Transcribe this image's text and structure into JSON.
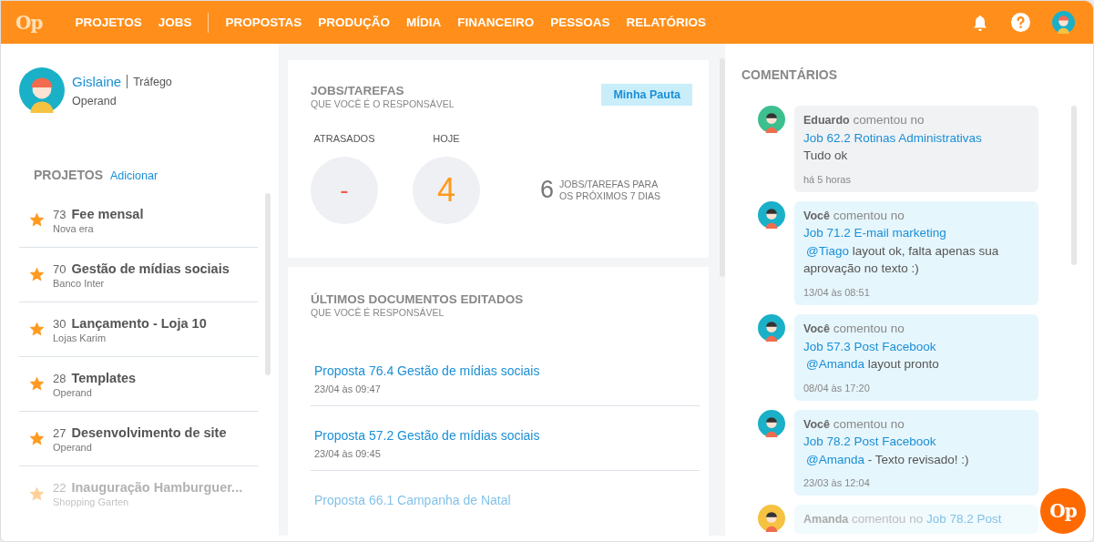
{
  "header": {
    "logo": "Op",
    "nav": [
      {
        "label": "PROJETOS",
        "selected": false
      },
      {
        "label": "JOBS",
        "selected": false
      },
      {
        "label": "PROPOSTAS",
        "selected": false
      },
      {
        "label": "PRODUÇÃO",
        "selected": false
      },
      {
        "label": "MÍDIA",
        "selected": false
      },
      {
        "label": "FINANCEIRO",
        "selected": false
      },
      {
        "label": "PESSOAS",
        "selected": false
      },
      {
        "label": "RELATÓRIOS",
        "selected": false
      }
    ]
  },
  "profile": {
    "name": "Gislaine",
    "role": "Tráfego",
    "company": "Operand"
  },
  "projects": {
    "title": "PROJETOS",
    "add_link": "Adicionar",
    "items": [
      {
        "number": "73",
        "name": "Fee mensal",
        "client": "Nova era",
        "starred": true
      },
      {
        "number": "70",
        "name": "Gestão de mídias sociais",
        "client": "Banco Inter",
        "starred": true
      },
      {
        "number": "30",
        "name": "Lançamento - Loja 10",
        "client": "Lojas Karim",
        "starred": true
      },
      {
        "number": "28",
        "name": "Templates",
        "client": "Operand",
        "starred": true
      },
      {
        "number": "27",
        "name": "Desenvolvimento de site",
        "client": "Operand",
        "starred": true
      },
      {
        "number": "22",
        "name": "Inauguração Hamburguer...",
        "client": "Shopping Garten",
        "starred": true
      }
    ]
  },
  "jobs_card": {
    "title": "JOBS/TAREFAS",
    "subtitle": "QUE VOCÊ É O RESPONSÁVEL",
    "button": "Minha Pauta",
    "stats": [
      {
        "label": "ATRASADOS",
        "value": "-",
        "kind": "late"
      },
      {
        "label": "HOJE",
        "value": "4",
        "kind": "today"
      }
    ],
    "upcoming_count": "6",
    "upcoming_label": "JOBS/TAREFAS PARA OS PRÓXIMOS 7 DIAS"
  },
  "docs_card": {
    "title": "ÚLTIMOS DOCUMENTOS EDITADOS",
    "subtitle": "QUE VOCÊ É RESPONSÁVEL",
    "items": [
      {
        "title": "Proposta 76.4 Gestão de mídias sociais",
        "date": "23/04 às 09:47"
      },
      {
        "title": "Proposta 57.2 Gestão de mídias sociais",
        "date": "23/04 às 09:45"
      },
      {
        "title": "Proposta 66.1 Campanha de Natal"
      }
    ]
  },
  "comments": {
    "title": "COMENTÁRIOS",
    "items": [
      {
        "author": "Eduardo",
        "verb": "comentou no",
        "link": "Job 62.2 Rotinas Administrativas",
        "text": "Tudo ok",
        "time": "há 5 horas",
        "kind": "other",
        "color": "#3dbf8f"
      },
      {
        "author": "Você",
        "verb": "comentou no",
        "link": "Job 71.2 E-mail marketing",
        "mention": "@Tiago",
        "text": "layout ok, falta apenas sua aprovação no texto :)",
        "time": "13/04 às 08:51",
        "kind": "own",
        "color": "#1ab0c8"
      },
      {
        "author": "Você",
        "verb": "comentou no",
        "link": "Job 57.3 Post Facebook",
        "mention": "@Amanda",
        "text": "layout pronto",
        "time": "08/04 às 17:20",
        "kind": "own",
        "color": "#1ab0c8"
      },
      {
        "author": "Você",
        "verb": "comentou no",
        "link": "Job 78.2 Post Facebook",
        "mention": "@Amanda",
        "text": "- Texto revisado! :)",
        "time": "23/03 às 12:04",
        "kind": "own",
        "color": "#1ab0c8"
      },
      {
        "author": "Amanda",
        "verb": "comentou no",
        "link": "Job 78.2 Post",
        "kind": "own",
        "color": "#f5c242"
      }
    ]
  },
  "fab": {
    "label": "Op"
  }
}
